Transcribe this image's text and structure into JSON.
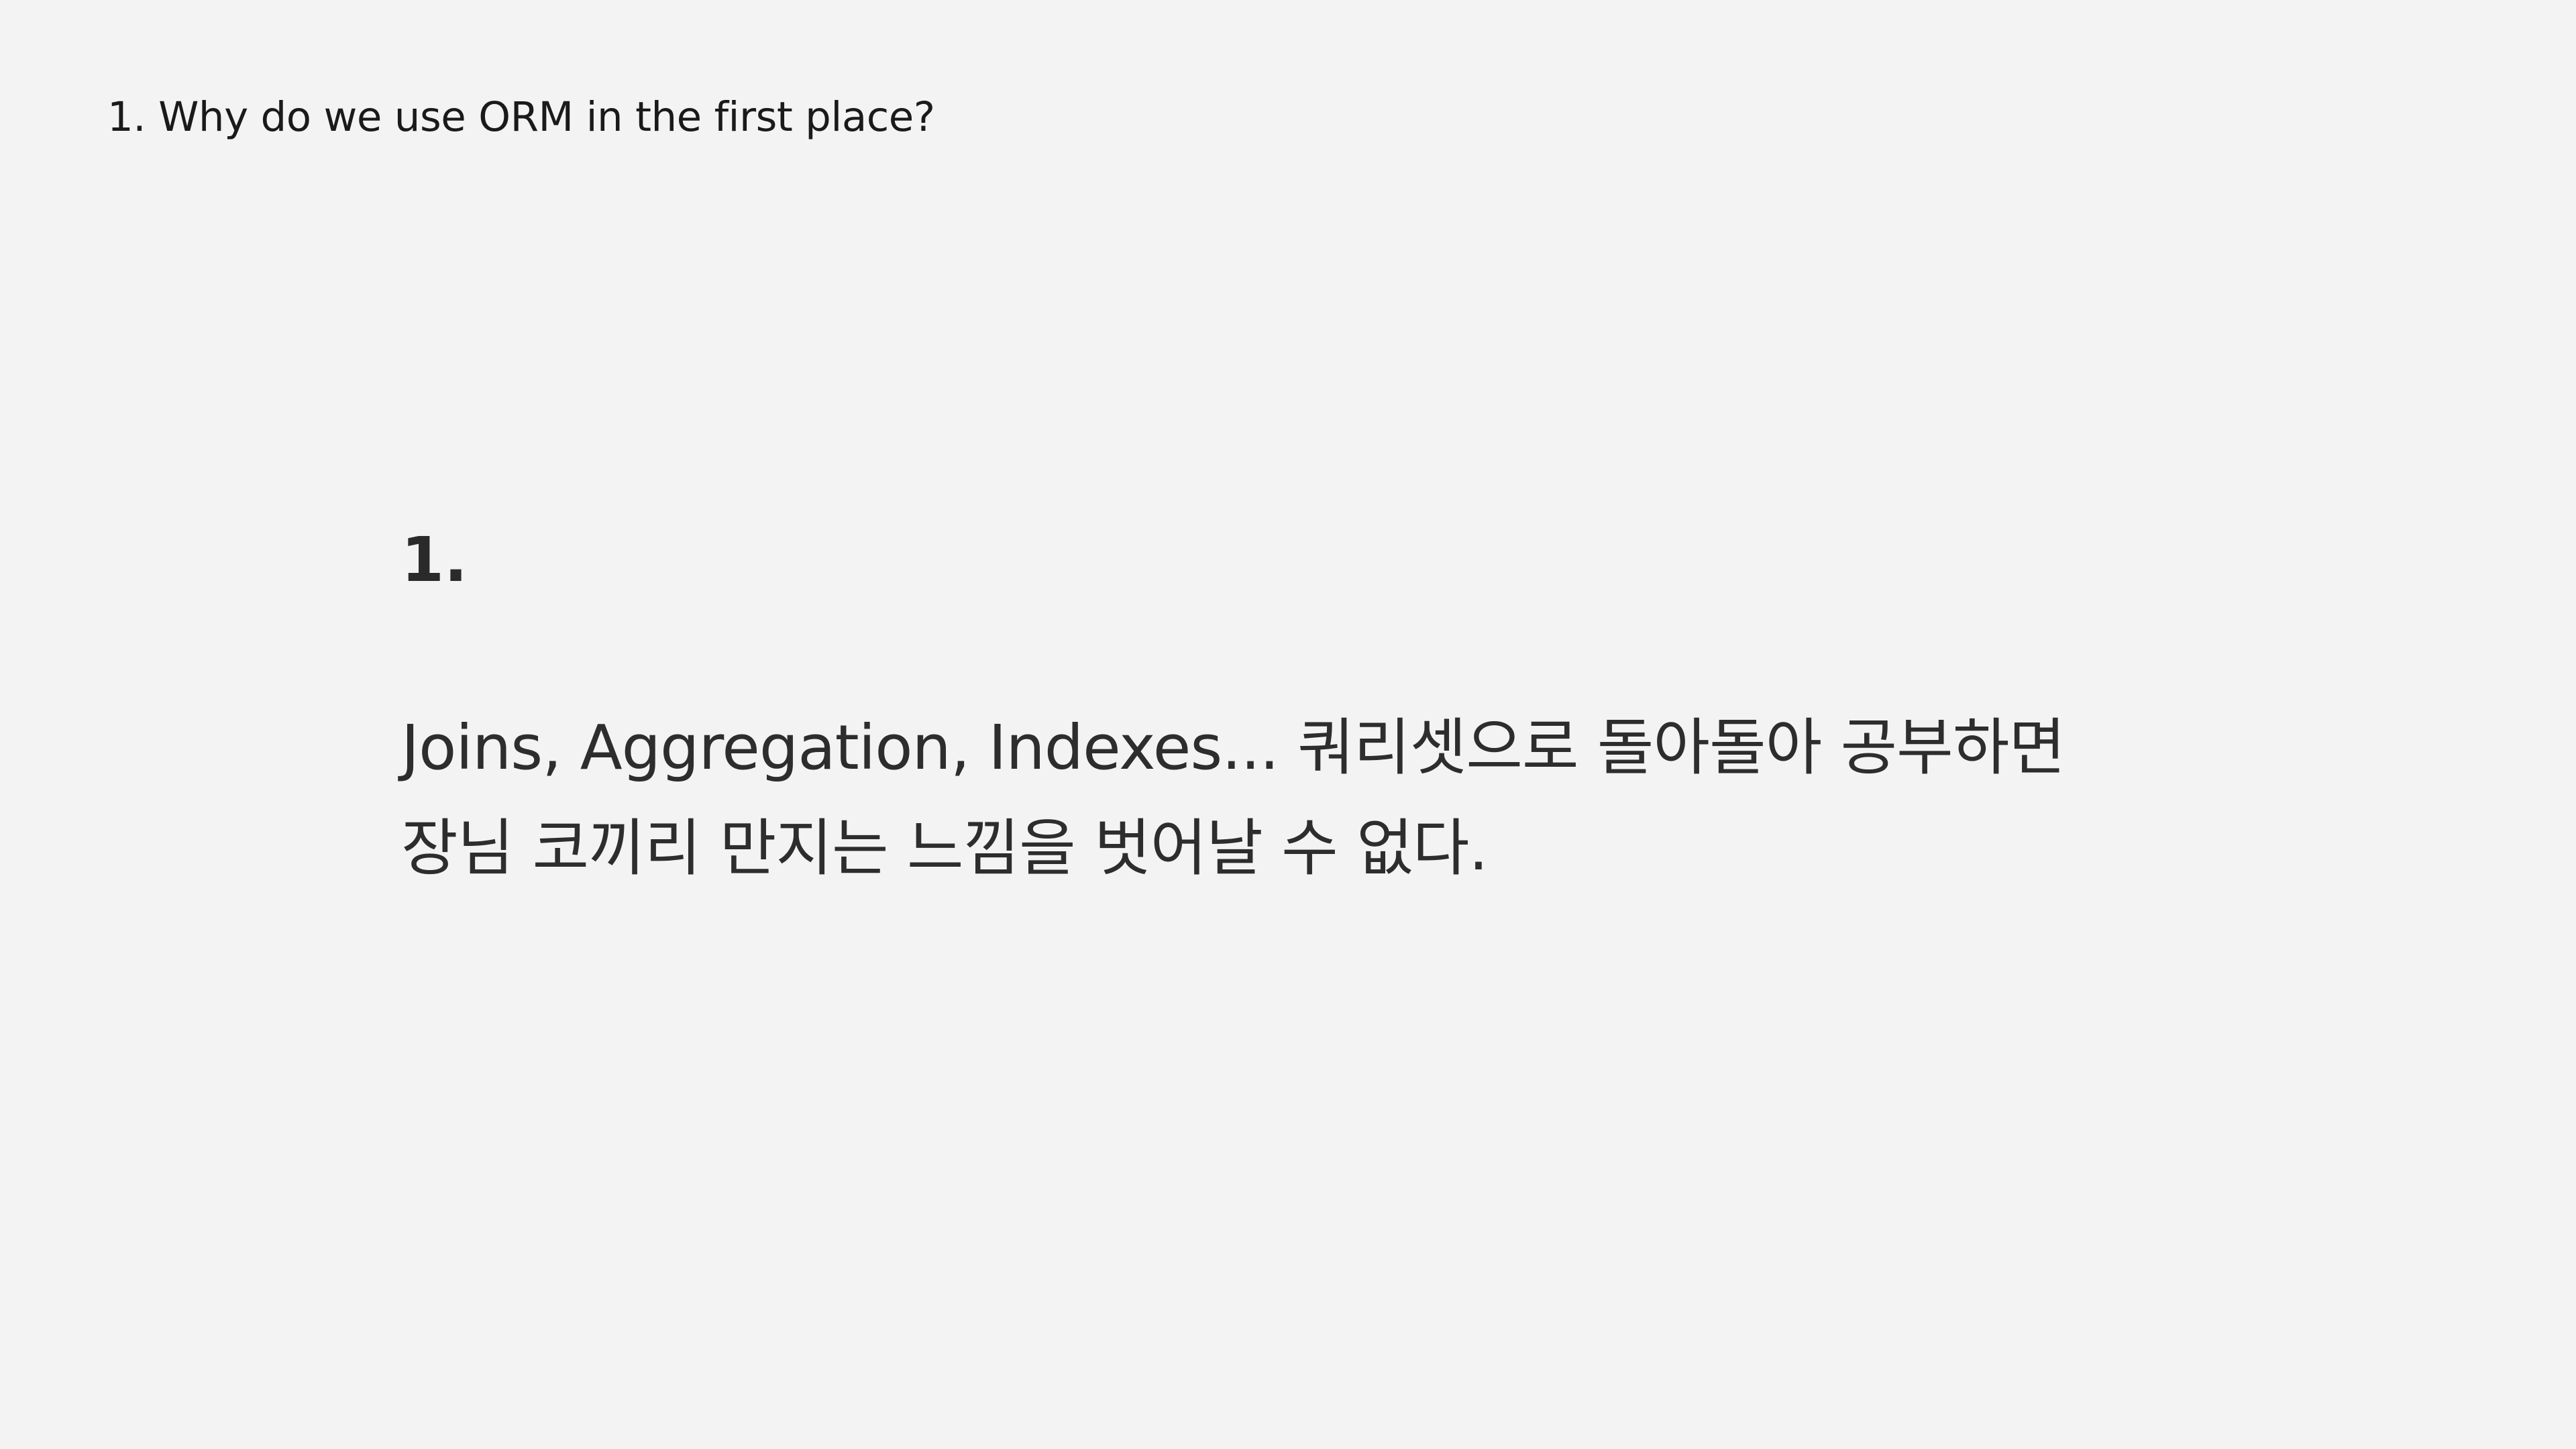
{
  "header": {
    "title": "1. Why do we use ORM in the first place?"
  },
  "content": {
    "section_number": "1.",
    "body_lines": [
      "Joins, Aggregation, Indexes... 쿼리셋으로 돌아돌아 공부하면",
      "장님 코끼리 만지는 느낌을 벗어날 수 없다."
    ]
  },
  "colors": {
    "background": "#f3f3f3",
    "text": "#2d2d2d"
  }
}
